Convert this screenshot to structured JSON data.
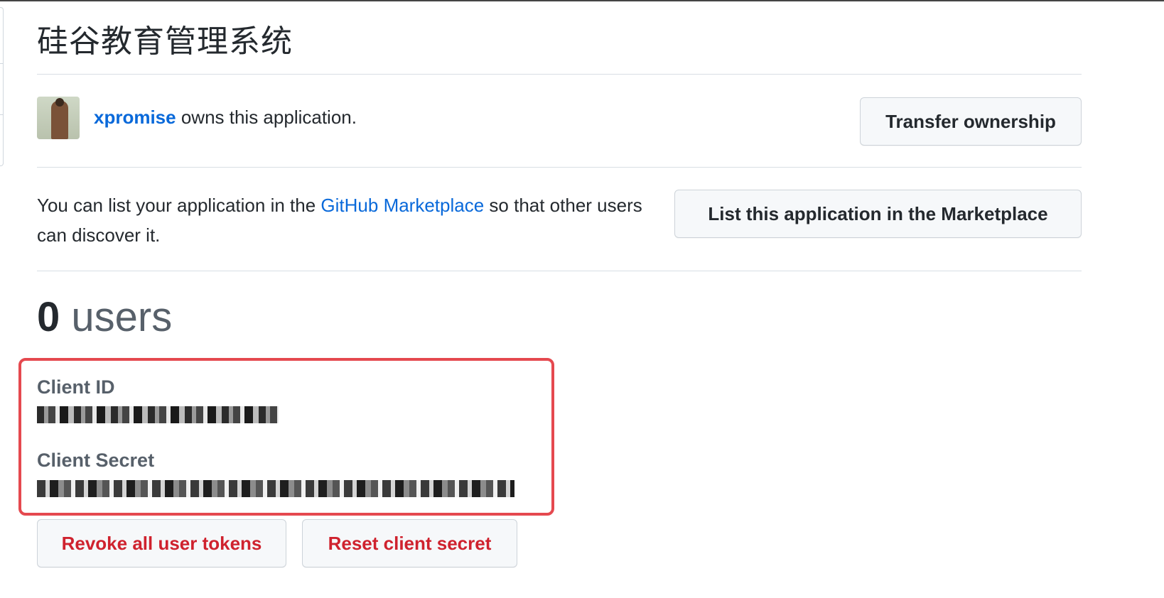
{
  "app": {
    "title": "硅谷教育管理系统"
  },
  "owner": {
    "username": "xpromise",
    "suffix": " owns this application.",
    "transfer_button": "Transfer ownership"
  },
  "marketplace": {
    "text_before": "You can list your application in the ",
    "link": "GitHub Marketplace",
    "text_after": " so that other users can discover it.",
    "button": "List this application in the Marketplace"
  },
  "users": {
    "count": "0",
    "label": " users"
  },
  "credentials": {
    "client_id_label": "Client ID",
    "client_secret_label": "Client Secret",
    "client_id_value": "[redacted]",
    "client_secret_value": "[redacted]"
  },
  "actions": {
    "revoke_button": "Revoke all user tokens",
    "reset_button": "Reset client secret"
  },
  "colors": {
    "link": "#0969da",
    "danger": "#cf222e",
    "highlight": "#e5494f"
  }
}
